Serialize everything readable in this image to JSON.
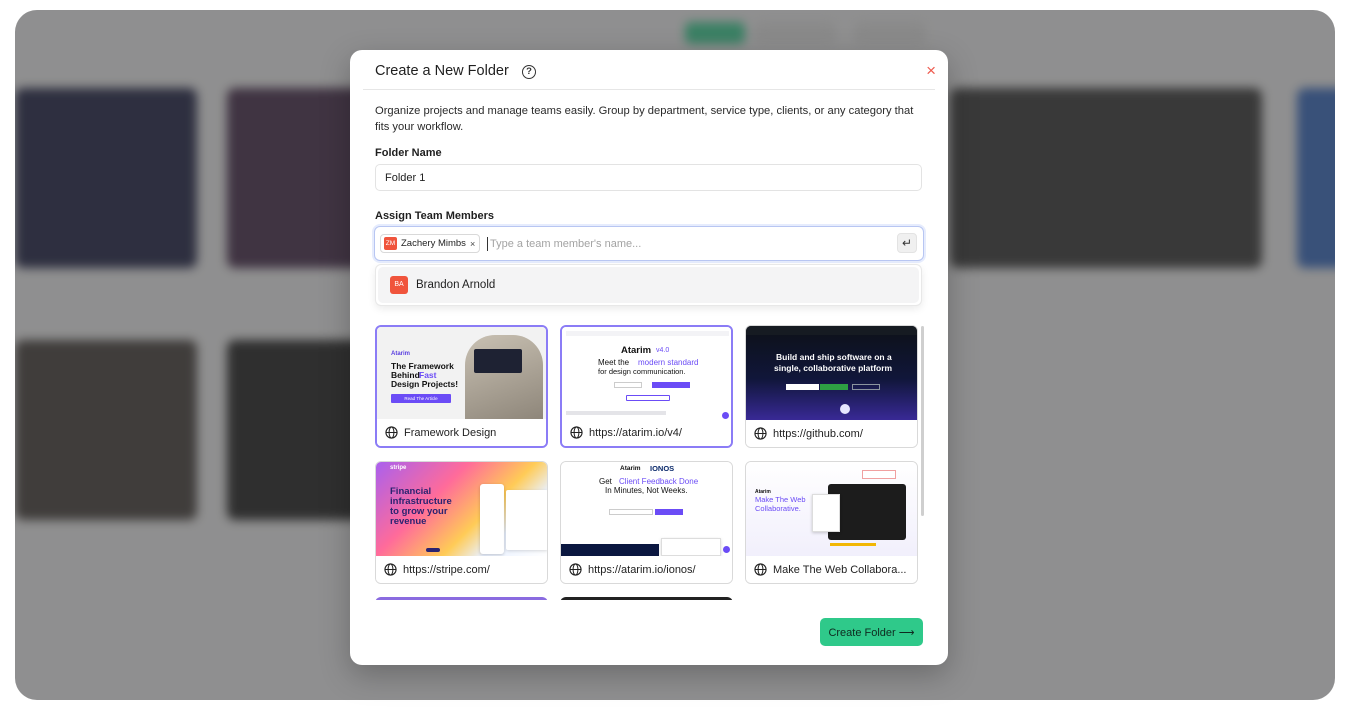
{
  "modal": {
    "title": "Create a New Folder",
    "help_icon": "?",
    "close_icon": "×",
    "description": "Organize projects and manage teams easily. Group by department, service type, clients, or any category that fits your workflow."
  },
  "folder_name": {
    "label": "Folder Name",
    "value": "Folder 1"
  },
  "assign": {
    "label": "Assign Team Members",
    "chip": {
      "initials": "ZM",
      "name": "Zachery Mimbs",
      "remove": "×"
    },
    "placeholder": "Type a team member's name...",
    "enter_icon": "↵",
    "suggestions": [
      {
        "initials": "BA",
        "name": "Brandon Arnold"
      }
    ]
  },
  "projects": [
    {
      "label": "Framework Design",
      "selected": true,
      "thumb": {
        "brand": "Atarim",
        "headline": "The Framework Behind Fast Design Projects!",
        "headline_parts": [
          "The Framework",
          "Behind ",
          "Fast",
          "Design Projects!"
        ],
        "cta": "Read The Article"
      }
    },
    {
      "label": "https://atarim.io/v4/",
      "selected": true,
      "thumb": {
        "brand": "Atarim",
        "version": "v4.0",
        "headline_parts": [
          "Meet the ",
          "modern standard",
          "for design communication."
        ]
      }
    },
    {
      "label": "https://github.com/",
      "selected": false,
      "thumb": {
        "headline_parts": [
          "Build and ship software on a",
          "single, collaborative platform"
        ]
      }
    },
    {
      "label": "https://stripe.com/",
      "selected": false,
      "thumb": {
        "brand": "stripe",
        "headline_parts": [
          "Financial",
          "infrastructure",
          "to grow your",
          "revenue"
        ]
      }
    },
    {
      "label": "https://atarim.io/ionos/",
      "selected": false,
      "thumb": {
        "brand": "Atarim",
        "partner": "IONOS",
        "headline_parts": [
          "Get ",
          "Client Feedback Done",
          "In Minutes, Not Weeks."
        ]
      }
    },
    {
      "label": "Make The Web Collabora...",
      "selected": false,
      "thumb": {
        "brand": "Atarim",
        "headline_parts": [
          "Make The Web",
          "Collaborative."
        ]
      }
    }
  ],
  "footer": {
    "create_label": "Create Folder ⟶"
  },
  "colors": {
    "accent_green": "#2fc98a",
    "selected_border": "#8b7cf6",
    "avatar_red": "#f0543c",
    "close_red": "#ee5a4e",
    "atarim_purple": "#6b4cf6"
  }
}
